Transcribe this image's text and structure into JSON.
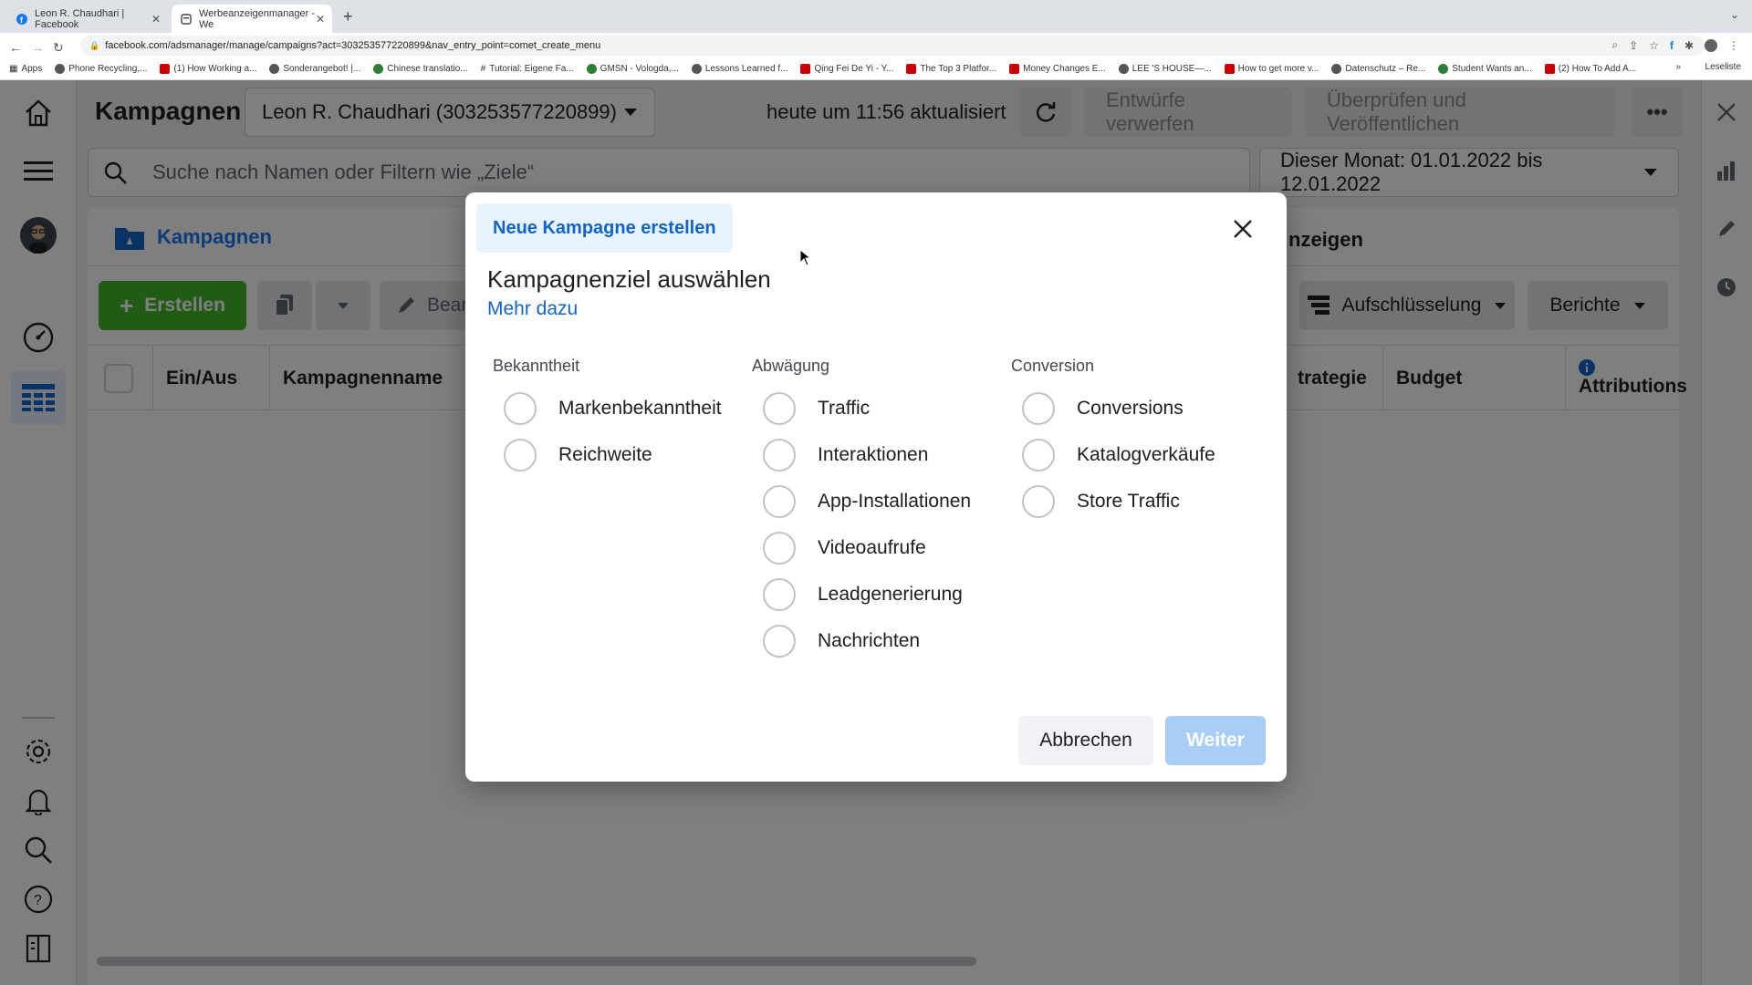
{
  "browser": {
    "tabs": [
      {
        "title": "Leon R. Chaudhari | Facebook",
        "close": "✕"
      },
      {
        "title": "Werbeanzeigenmanager - We",
        "close": "✕"
      }
    ],
    "new_tab": "+",
    "url": "facebook.com/adsmanager/manage/campaigns?act=303253577220899&nav_entry_point=comet_create_menu",
    "bookmarks": [
      "Apps",
      "Phone Recycling,...",
      "(1) How Working a...",
      "Sonderangebot! |...",
      "Chinese translatio...",
      "Tutorial: Eigene Fa...",
      "GMSN - Vologda,...",
      "Lessons Learned f...",
      "Qing Fei De Yi - Y...",
      "The Top 3 Platfor...",
      "Money Changes E...",
      "LEE 'S HOUSE—...",
      "How to get more v...",
      "Datenschutz – Re...",
      "Student Wants an...",
      "(2) How To Add A..."
    ],
    "more_bookmarks": "»",
    "reading_list": "Leseliste"
  },
  "header": {
    "title": "Kampagnen",
    "account": "Leon R. Chaudhari (303253577220899)",
    "updated": "heute um 11:56 aktualisiert",
    "discard": "Entwürfe verwerfen",
    "review": "Überprüfen und Veröffentlichen",
    "more": "•••"
  },
  "search": {
    "placeholder": "Suche nach Namen oder Filtern wie „Ziele“"
  },
  "date_range": "Dieser Monat: 01.01.2022 bis 12.01.2022",
  "panel": {
    "tab_campaigns": "Kampagnen",
    "tab_ads": "nzeigen",
    "create": "Erstellen",
    "edit_partial": "Bear",
    "breakdown": "Aufschlüsselung",
    "reports": "Berichte",
    "columns": [
      "Ein/Aus",
      "Kampagnenname",
      "trategie",
      "Budget",
      "Attributions"
    ]
  },
  "modal": {
    "tab": "Neue Kampagne erstellen",
    "heading": "Kampagnenziel auswählen",
    "learn_more": "Mehr dazu",
    "columns": [
      {
        "header": "Bekanntheit",
        "options": [
          "Markenbekanntheit",
          "Reichweite"
        ]
      },
      {
        "header": "Abwägung",
        "options": [
          "Traffic",
          "Interaktionen",
          "App-Installationen",
          "Videoaufrufe",
          "Leadgenerierung",
          "Nachrichten"
        ]
      },
      {
        "header": "Conversion",
        "options": [
          "Conversions",
          "Katalogverkäufe",
          "Store Traffic"
        ]
      }
    ],
    "cancel": "Abbrechen",
    "next": "Weiter"
  },
  "colors": {
    "accent_blue": "#1464c8",
    "create_green": "#42b72a",
    "next_disabled": "#a8cef8"
  }
}
